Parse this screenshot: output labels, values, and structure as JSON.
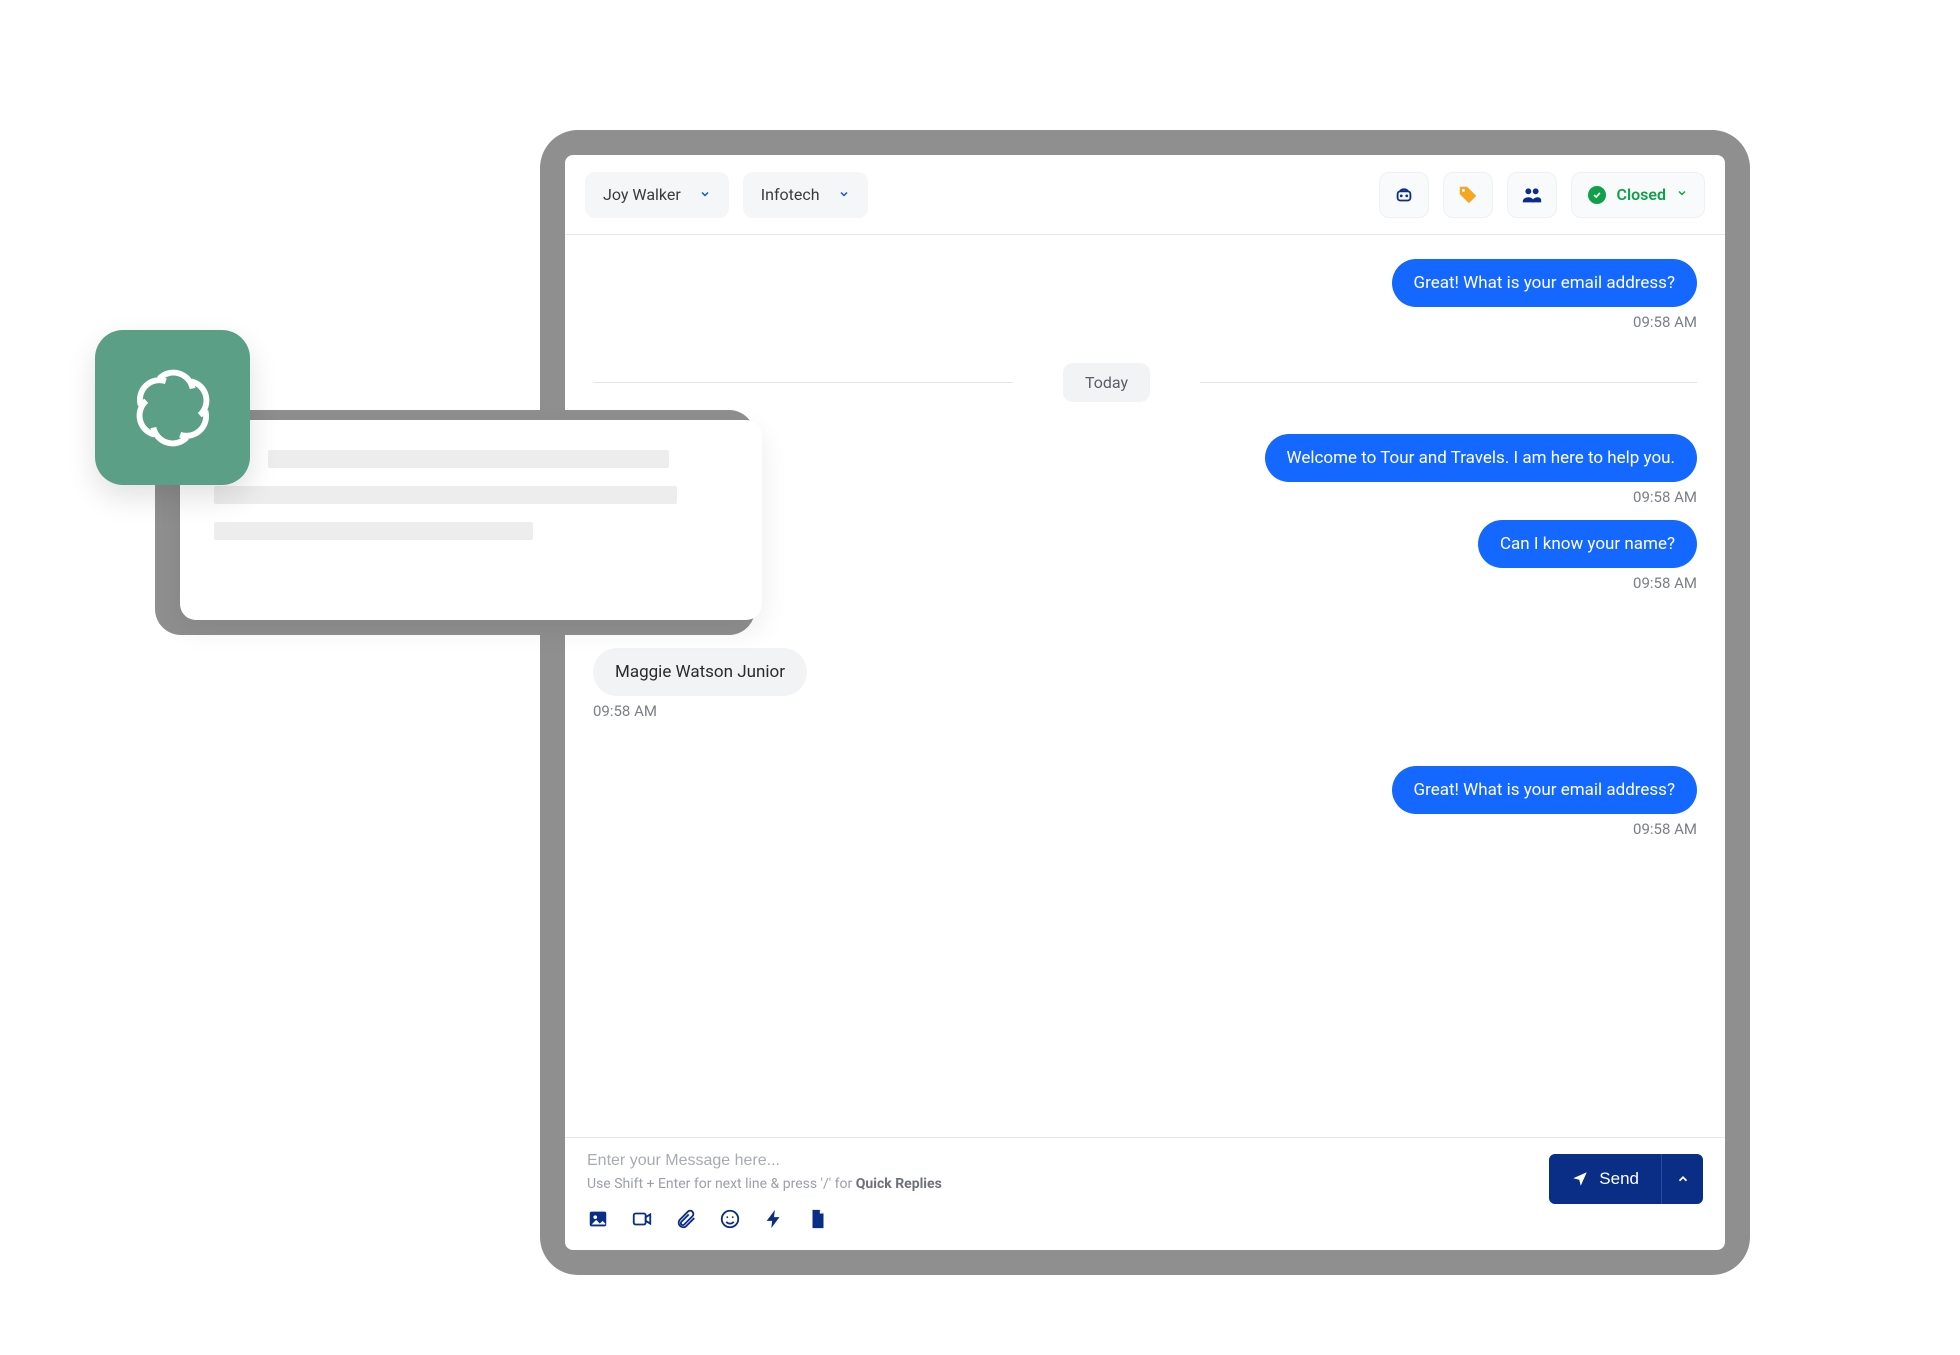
{
  "header": {
    "contact_name": "Joy Walker",
    "company_name": "Infotech",
    "status_label": "Closed"
  },
  "divider": {
    "label": "Today"
  },
  "messages": [
    {
      "side": "out",
      "text": "Great! What is your email address?",
      "time": "09:58 AM"
    },
    {
      "side": "out",
      "text": "Welcome to Tour and Travels. I am here to help you.",
      "time": "09:58 AM"
    },
    {
      "side": "out",
      "text": "Can I know your name?",
      "time": "09:58 AM"
    },
    {
      "side": "in",
      "text": "Maggie Watson Junior",
      "time": "09:58 AM"
    },
    {
      "side": "out",
      "text": "Great! What is your email address?",
      "time": "09:58 AM"
    }
  ],
  "composer": {
    "placeholder": "Enter your Message here...",
    "hint_prefix": "Use Shift + Enter for next line & press '/' for ",
    "hint_bold": "Quick Replies",
    "send_label": "Send"
  }
}
